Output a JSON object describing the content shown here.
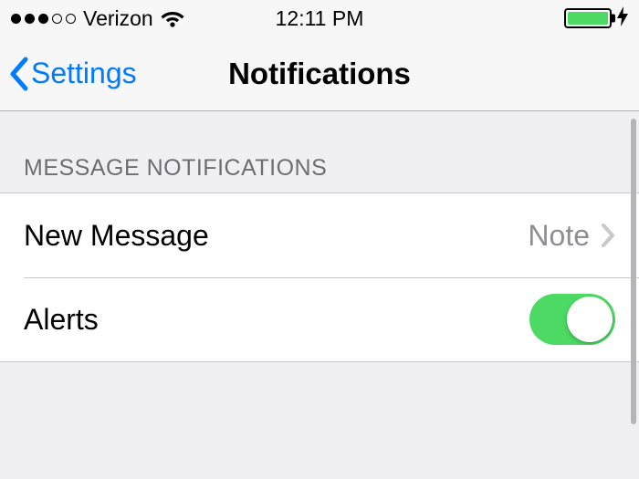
{
  "status_bar": {
    "carrier": "Verizon",
    "time": "12:11 PM"
  },
  "nav": {
    "back_label": "Settings",
    "title": "Notifications"
  },
  "section": {
    "header": "MESSAGE NOTIFICATIONS",
    "rows": {
      "new_message": {
        "label": "New Message",
        "value": "Note"
      },
      "alerts": {
        "label": "Alerts",
        "on": true
      }
    }
  }
}
